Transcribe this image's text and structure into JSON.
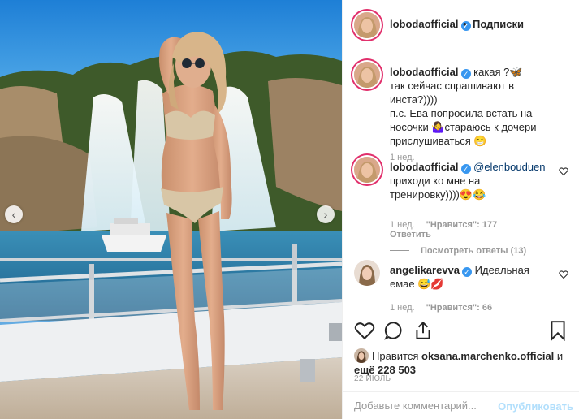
{
  "post": {
    "username": "lobodaofficial",
    "follow_label": "Подписки",
    "separator": "•"
  },
  "comments": [
    {
      "username": "lobodaofficial",
      "line1": "какая ?🦋",
      "line2": "так сейчас спрашивают в инста?))))",
      "line3": "п.с. Ева попросила встать на",
      "line4": "носочки 🤷‍♀️стараюсь к дочери",
      "line5": "прислушиваться 😁",
      "time": "1 нед."
    },
    {
      "username": "lobodaofficial",
      "mention": "@elenbouduen",
      "line2": "приходи ко мне на",
      "line3": "тренировку))))😍😂",
      "time": "1 нед.",
      "likes": "\"Нравится\": 177",
      "reply": "Ответить",
      "view_replies": "Посмотреть ответы (13)"
    },
    {
      "username": "angelikarevva",
      "line1": "Идеальная",
      "line2": "емае 😅💋",
      "time": "1 нед.",
      "likes": "\"Нравится\": 66"
    }
  ],
  "likes": {
    "prefix": "Нравится",
    "user": "oksana.marchenko.official",
    "conj": "и",
    "count": "ещё 228 503"
  },
  "date": "22 ИЮЛЬ",
  "add_comment": {
    "placeholder": "Добавьте комментарий...",
    "publish": "Опубликовать"
  },
  "icons": {
    "like": "heart-icon",
    "comment": "comment-icon",
    "share": "share-icon",
    "save": "bookmark-icon",
    "verified": "verified-badge-icon"
  },
  "colors": {
    "accent": "#3897f0",
    "text": "#262626",
    "muted": "#999999",
    "publish_disabled": "#b2dffc",
    "sky": "#2f8fd8"
  }
}
